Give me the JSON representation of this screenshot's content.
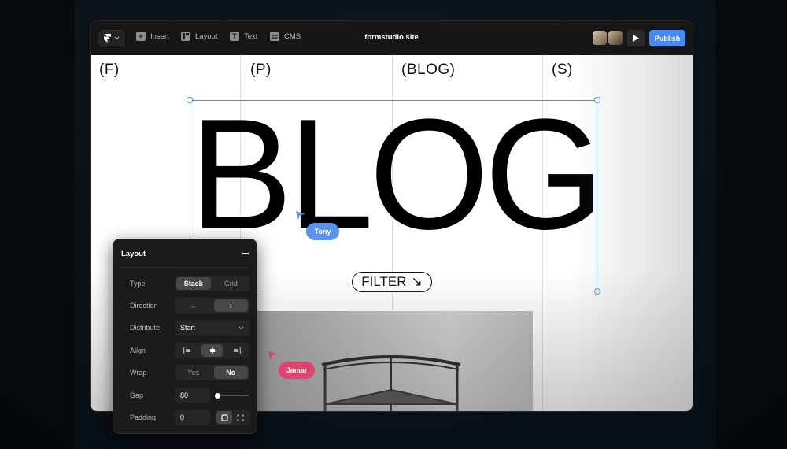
{
  "toolbar": {
    "insert_label": "Insert",
    "layout_label": "Layout",
    "text_label": "Text",
    "cms_label": "CMS",
    "site_title": "formstudio.site",
    "publish_label": "Publish"
  },
  "canvas": {
    "nav": [
      "(F)",
      "(P)",
      "(BLOG)",
      "(S)"
    ],
    "hero_text": "BLOG",
    "filter_label": "FILTER",
    "filter_arrow": "↘"
  },
  "collaborators": [
    {
      "name": "Tony",
      "color": "#5b93ef"
    },
    {
      "name": "Jamar",
      "color": "#e0436e"
    }
  ],
  "layout_panel": {
    "title": "Layout",
    "type": {
      "label": "Type",
      "options": [
        "Stack",
        "Grid"
      ],
      "selected": "Stack"
    },
    "direction": {
      "label": "Direction",
      "options": [
        "↔",
        "↕"
      ],
      "selected": "↕"
    },
    "distribute": {
      "label": "Distribute",
      "value": "Start"
    },
    "align": {
      "label": "Align",
      "options": [
        "start",
        "center",
        "end"
      ],
      "selected": "center"
    },
    "wrap": {
      "label": "Wrap",
      "options": [
        "Yes",
        "No"
      ],
      "selected": "No"
    },
    "gap": {
      "label": "Gap",
      "value": "80"
    },
    "padding": {
      "label": "Padding",
      "value": "0"
    }
  },
  "colors": {
    "accent": "#4a8af0",
    "panel_bg": "#1b1b1b",
    "canvas_bg": "#ffffff"
  },
  "icons": {
    "logo": "framer-logo-icon",
    "play": "play-icon",
    "insert": "plus-icon",
    "layout": "layout-icon",
    "text": "text-icon",
    "cms": "database-icon"
  }
}
